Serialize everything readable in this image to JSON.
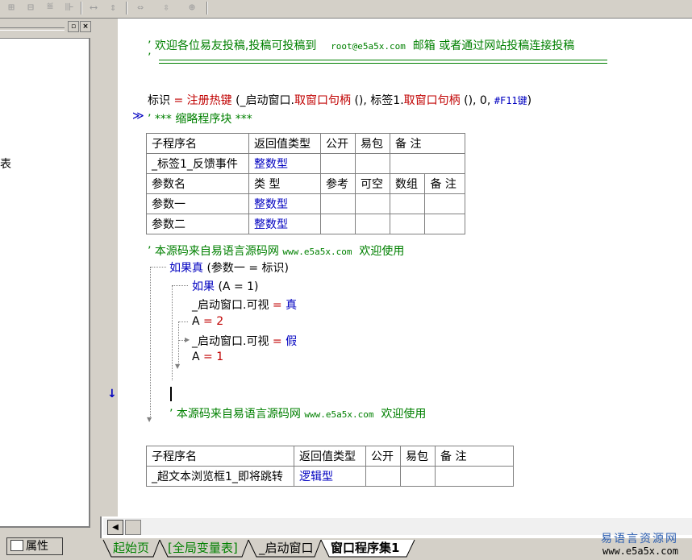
{
  "toolbar": {
    "icons": [
      "merge-cells-icon",
      "split-cells-icon",
      "insert-row-icon",
      "insert-col-icon",
      "same-width-icon",
      "same-height-icon",
      "h-spacing-icon",
      "v-spacing-icon",
      "center-icon"
    ]
  },
  "left_panel": {
    "close_btn": "×",
    "min_btn": "▫",
    "fragment": "表",
    "properties_tab": "属性"
  },
  "code": {
    "comment1_prefix": "’",
    "comment1_text": "欢迎各位易友投稿,投稿可投稿到",
    "comment1_email": "root@e5a5x.com",
    "comment1_rest": "邮箱 或者通过网站投稿连接投稿",
    "comment2_prefix": "’",
    "assign_lhs": "标识",
    "assign_eq": "=",
    "assign_func": "注册热键",
    "assign_args_a": "(_启动窗口.",
    "assign_method1": "取窗口句柄",
    "assign_args_b": "(), 标签1.",
    "assign_method2": "取窗口句柄",
    "assign_args_c": "(), 0,",
    "assign_key": "#F11键",
    "assign_close": ")",
    "collapsed_marker": "≫",
    "collapsed_text": "’ *** 缩略程序块 ***",
    "src_comment": "’ 本源码来自易语言源码网",
    "src_site": "www.e5a5x.com",
    "src_welcome": "欢迎使用",
    "if_true": "如果真",
    "if_true_cond": "(参数一 = 标识)",
    "if_kw": "如果",
    "if_cond": "(A = 1)",
    "show_lhs": "_启动窗口.可视",
    "eq": "=",
    "true_kw": "真",
    "a_eq_2_lhs": "A",
    "a_eq_2_rhs": "2",
    "hide_lhs": "_启动窗口.可视",
    "false_kw": "假",
    "a_eq_1_lhs": "A",
    "a_eq_1_rhs": "1",
    "arrow_marker": "↓",
    "src_comment2": "’ 本源码来自易语言源码网",
    "src_site2": "www.e5a5x.com",
    "src_welcome2": "欢迎使用"
  },
  "sub1": {
    "headers": [
      "子程序名",
      "返回值类型",
      "公开",
      "易包",
      "备 注"
    ],
    "row": [
      "_标签1_反馈事件",
      "整数型",
      "",
      "",
      ""
    ],
    "param_headers": [
      "参数名",
      "类 型",
      "参考",
      "可空",
      "数组",
      "备 注"
    ],
    "params": [
      [
        "参数一",
        "整数型",
        "",
        "",
        "",
        ""
      ],
      [
        "参数二",
        "整数型",
        "",
        "",
        "",
        ""
      ]
    ]
  },
  "sub2": {
    "headers": [
      "子程序名",
      "返回值类型",
      "公开",
      "易包",
      "备 注"
    ],
    "row": [
      "_超文本浏览框1_即将跳转",
      "逻辑型",
      "",
      "",
      ""
    ]
  },
  "tabs": [
    {
      "label": "起始页",
      "active": false
    },
    {
      "label": "[全局变量表]",
      "active": false
    },
    {
      "label": "_启动窗口",
      "active": false
    },
    {
      "label": "窗口程序集1",
      "active": true
    }
  ],
  "watermark": {
    "line1": "易语言资源网",
    "line2": "www.e5a5x.com"
  },
  "colors": {
    "comment": "#008000",
    "keyword": "#c00000",
    "type": "#0000c0",
    "active_tab_text": "#000000",
    "inactive_tab_text": "#008000"
  }
}
